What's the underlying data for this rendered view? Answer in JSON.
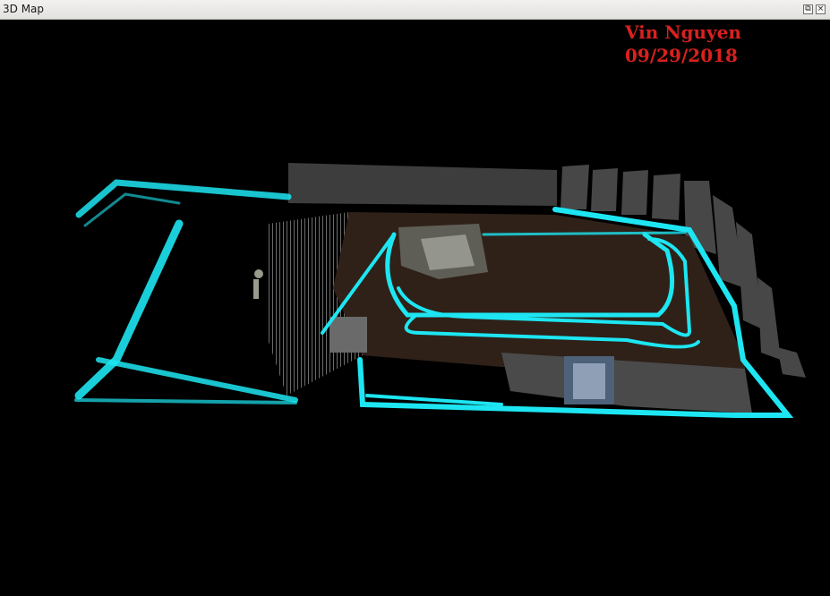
{
  "window": {
    "title": "3D Map",
    "restore_glyph": "⧉",
    "close_glyph": "×"
  },
  "watermark": {
    "author": "Vin Nguyen",
    "date": "09/29/2018"
  },
  "colors": {
    "path_cyan": "#1de6f2",
    "floor_brown": "#2f2118",
    "wall_gray": "#3d3d3d",
    "watermark_red": "#d9211f"
  },
  "icons": [
    "restore-icon",
    "close-icon"
  ]
}
